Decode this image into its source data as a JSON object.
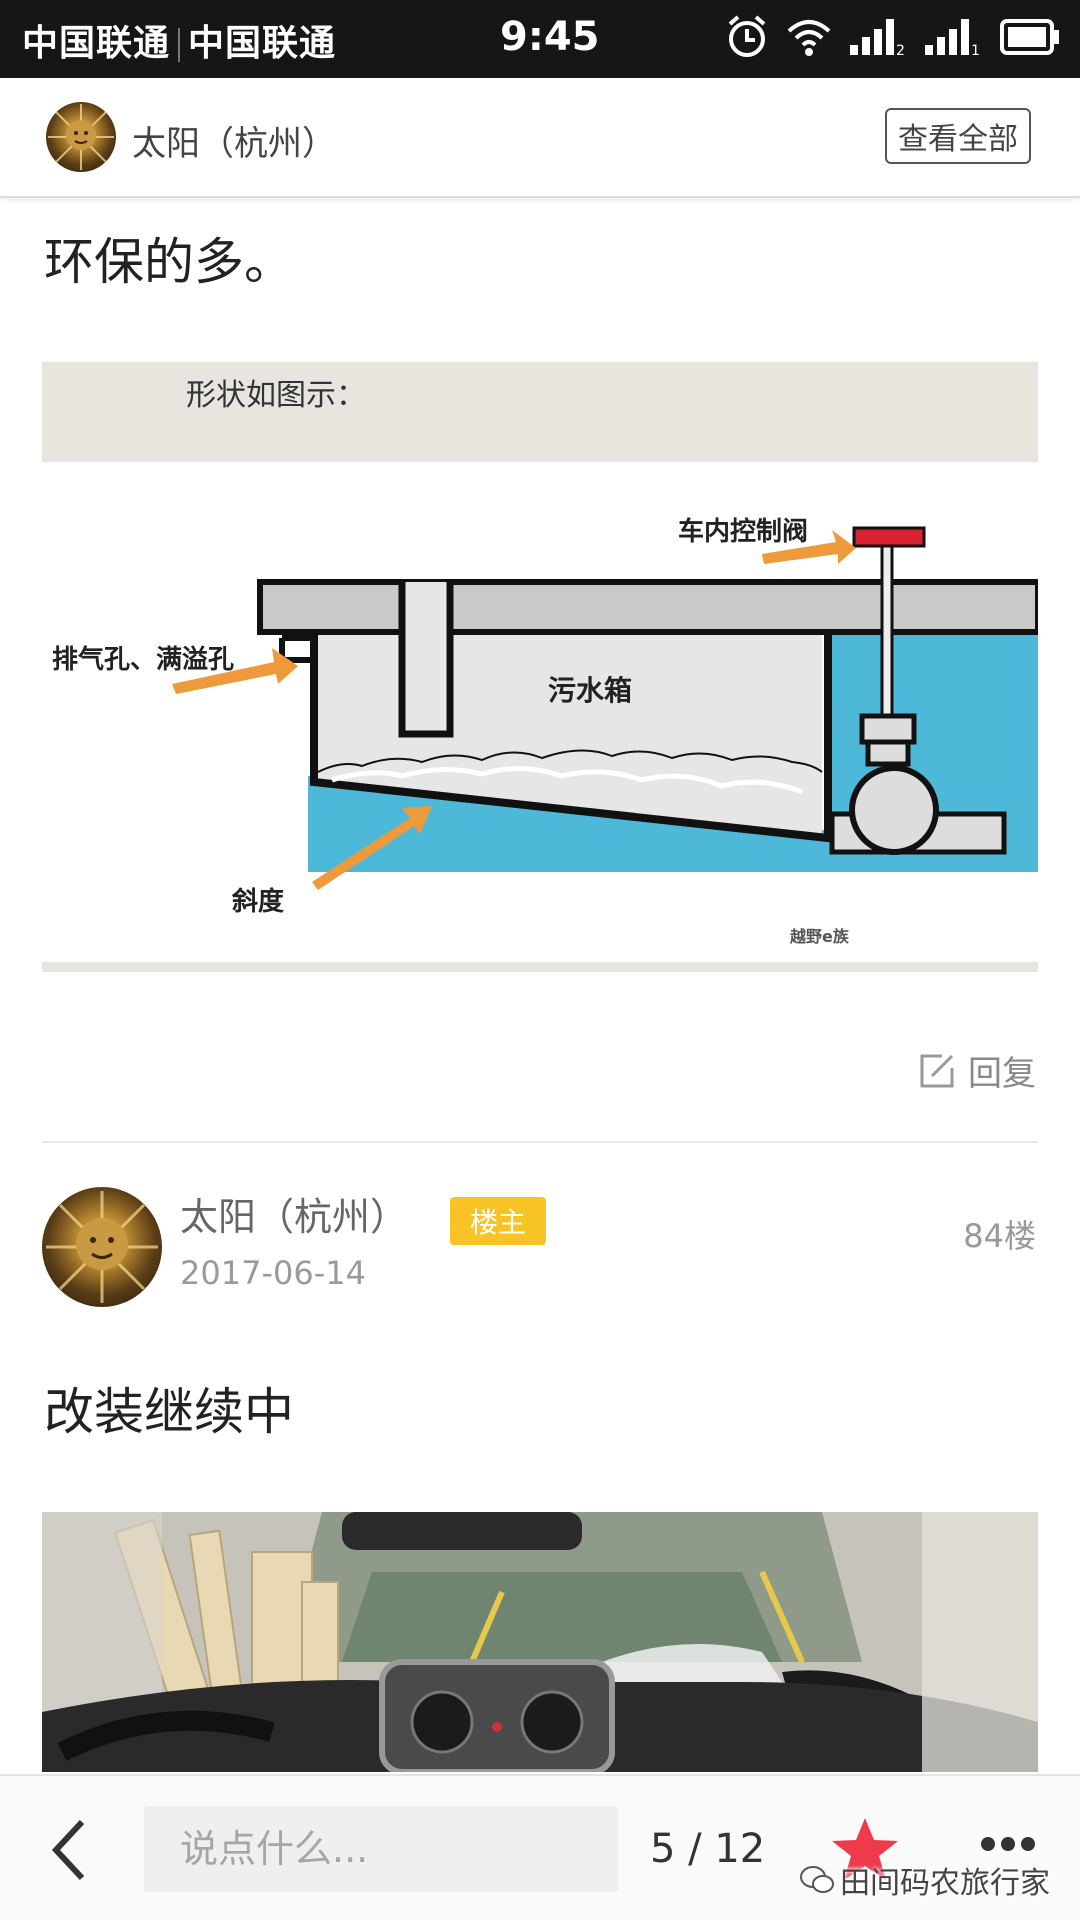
{
  "status_bar": {
    "carrier_1": "中国联通",
    "carrier_2": "中国联通",
    "time": "9:45",
    "icons": [
      "alarm-icon",
      "wifi-icon",
      "signal-icon",
      "signal-icon",
      "battery-icon"
    ]
  },
  "header": {
    "author": "太阳（杭州）",
    "view_all_label": "查看全部"
  },
  "post_prev": {
    "text": "环保的多。",
    "diagram": {
      "caption": "形状如图示：",
      "labels": {
        "control_valve": "车内控制阀",
        "vent": "排气孔、满溢孔",
        "tank": "污水箱",
        "slope": "斜度",
        "watermark": "越野e族"
      }
    },
    "reply_label": "回复"
  },
  "post": {
    "author": "太阳（杭州）",
    "badge": "楼主",
    "floor": "84楼",
    "date": "2017-06-14",
    "text": "改装继续中"
  },
  "bottom_bar": {
    "input_placeholder": "说点什么...",
    "page_counter": "5 / 12",
    "watermark_text": "田间码农旅行家"
  },
  "colors": {
    "status_bar_bg": "#161616",
    "badge": "#f7c325",
    "star": "#ef3a4c",
    "water": "#4db8d8",
    "arrow": "#ee9a3c"
  }
}
